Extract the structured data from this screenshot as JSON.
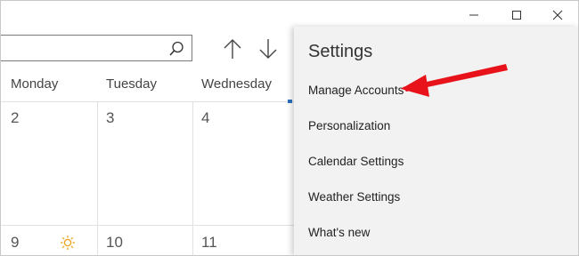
{
  "window": {
    "minimize_icon": "minimize-icon",
    "maximize_icon": "maximize-icon",
    "close_icon": "close-icon"
  },
  "search": {
    "value": "",
    "icon": "search-icon"
  },
  "navigation": {
    "up_icon": "arrow-up-icon",
    "down_icon": "arrow-down-icon"
  },
  "calendar": {
    "days": [
      "Monday",
      "Tuesday",
      "Wednesday"
    ],
    "week1": [
      "2",
      "3",
      "4"
    ],
    "week2": [
      "9",
      "10",
      "11"
    ],
    "weather_icon": "sun-icon",
    "today_color": "#2a6fbf"
  },
  "settings": {
    "title": "Settings",
    "items": [
      "Manage Accounts",
      "Personalization",
      "Calendar Settings",
      "Weather Settings",
      "What's new"
    ],
    "annotation_color": "#e8121b"
  }
}
